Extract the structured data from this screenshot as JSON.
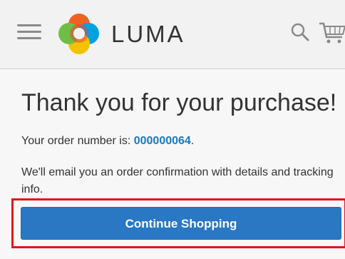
{
  "header": {
    "brand": "LUMA",
    "icons": {
      "menu": "hamburger-menu-icon",
      "logo": "luma-logo-icon",
      "search": "search-icon",
      "cart": "shopping-cart-icon"
    },
    "logo_colors": [
      "#f26322",
      "#00a1e1",
      "#f4c300",
      "#6fbe44",
      "#e8483f"
    ]
  },
  "main": {
    "title": "Thank you for your purchase!",
    "order_prefix": "Your order number is: ",
    "order_number": "000000064",
    "order_suffix": ".",
    "email_note": "We'll email you an order confirmation with details and tracking info.",
    "continue_label": "Continue Shopping"
  },
  "colors": {
    "accent": "#1979c3",
    "button": "#2a78c4",
    "highlight": "#e0161d"
  }
}
